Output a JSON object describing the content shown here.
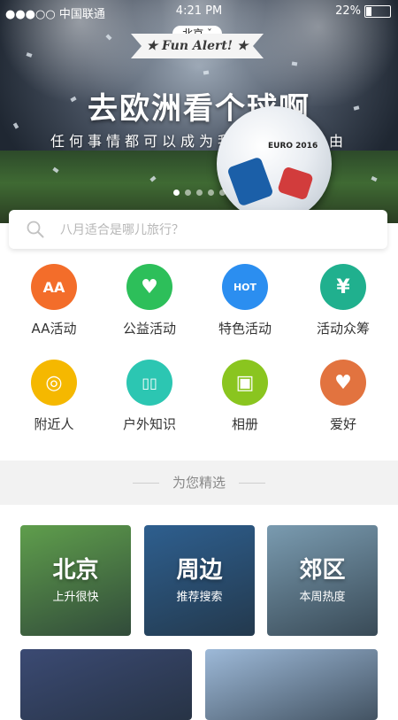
{
  "status": {
    "carrier": "●●●○○ 中国联通",
    "time": "4:21 PM",
    "battery": "22%",
    "battery_level": 0.22
  },
  "banner": {
    "city_tag": "北京 ˇ",
    "ribbon": "★ Fun Alert! ★",
    "headline": "去欧洲看个球啊",
    "subline": "任何事情都可以成为我们旅行的理由",
    "ball_text": "EURO 2016",
    "dots_count": 5,
    "active_dot": 0
  },
  "search": {
    "placeholder": "八月适合是哪儿旅行？"
  },
  "categories": [
    {
      "label": "AA活动",
      "color": "#f36d2a",
      "icon": "aa-icon",
      "glyph": "AA"
    },
    {
      "label": "公益活动",
      "color": "#2dbf5a",
      "icon": "heart-hand-icon",
      "glyph": "♥"
    },
    {
      "label": "特色活动",
      "color": "#2b8ef0",
      "icon": "hot-fire-icon",
      "glyph": "HOT"
    },
    {
      "label": "活动众筹",
      "color": "#20b08e",
      "icon": "yen-hand-icon",
      "glyph": "¥"
    },
    {
      "label": "附近人",
      "color": "#f5b800",
      "icon": "radar-icon",
      "glyph": "◎"
    },
    {
      "label": "户外知识",
      "color": "#2cc6b2",
      "icon": "book-icon",
      "glyph": "▯▯"
    },
    {
      "label": "相册",
      "color": "#8ac51f",
      "icon": "album-icon",
      "glyph": "▣"
    },
    {
      "label": "爱好",
      "color": "#e2733f",
      "icon": "heart-bubble-icon",
      "glyph": "♥"
    }
  ],
  "section": {
    "title": "为您精选"
  },
  "cards": [
    {
      "title": "北京",
      "subtitle": "上升很快",
      "color": "#5f9e4c"
    },
    {
      "title": "周边",
      "subtitle": "推荐搜索",
      "color": "#2e5f8f"
    },
    {
      "title": "郊区",
      "subtitle": "本周热度",
      "color": "#7a9bb0"
    },
    {
      "color": "#3b4a73"
    },
    {
      "color": "#9db9d8"
    }
  ]
}
